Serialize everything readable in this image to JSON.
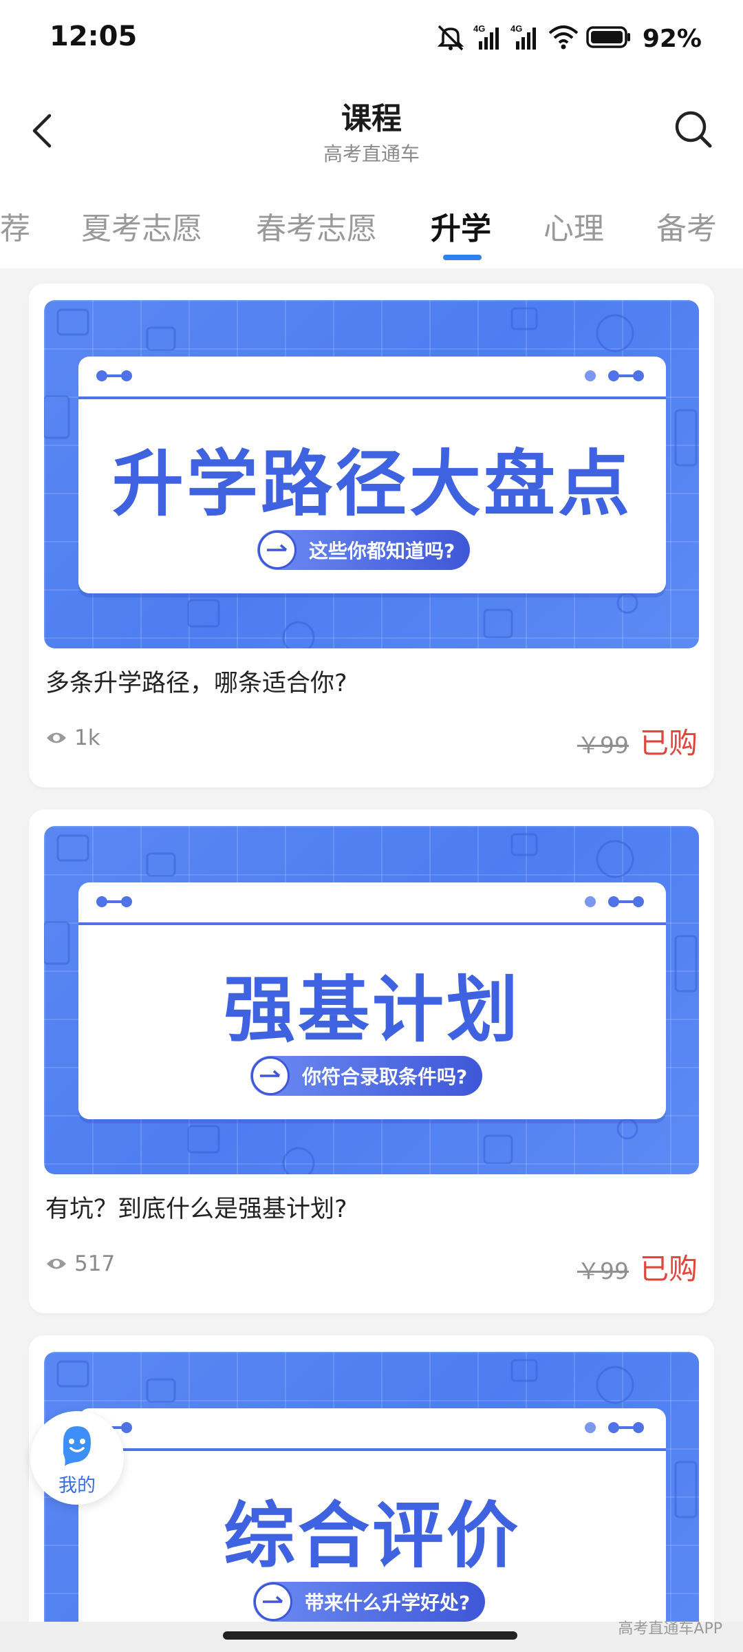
{
  "status_bar": {
    "time": "12:05",
    "network_1": "4G",
    "network_2": "4G",
    "battery": "92%"
  },
  "header": {
    "title": "课程",
    "subtitle": "高考直通车",
    "back_icon": "chevron-left-icon",
    "search_icon": "search-icon"
  },
  "tabs": [
    {
      "label": "荐",
      "active": false
    },
    {
      "label": "夏考志愿",
      "active": false
    },
    {
      "label": "春考志愿",
      "active": false
    },
    {
      "label": "升学",
      "active": true
    },
    {
      "label": "心理",
      "active": false
    },
    {
      "label": "备考",
      "active": false
    }
  ],
  "courses": [
    {
      "banner_title": "升学路径大盘点",
      "banner_tagline": "这些你都知道吗?",
      "title": "多条升学路径，哪条适合你?",
      "views": "1k",
      "original_price": "￥99",
      "status": "已购"
    },
    {
      "banner_title": "强基计划",
      "banner_tagline": "你符合录取条件吗?",
      "title": "有坑？到底什么是强基计划?",
      "views": "517",
      "original_price": "￥99",
      "status": "已购"
    },
    {
      "banner_title": "综合评价",
      "banner_tagline": "带来什么升学好处?"
    }
  ],
  "float_button": {
    "label": "我的",
    "icon": "robot-icon"
  },
  "watermark": "高考直通车APP",
  "colors": {
    "accent": "#2f80ed",
    "banner_blue": "#4d7df0",
    "price_red": "#e0453b"
  }
}
